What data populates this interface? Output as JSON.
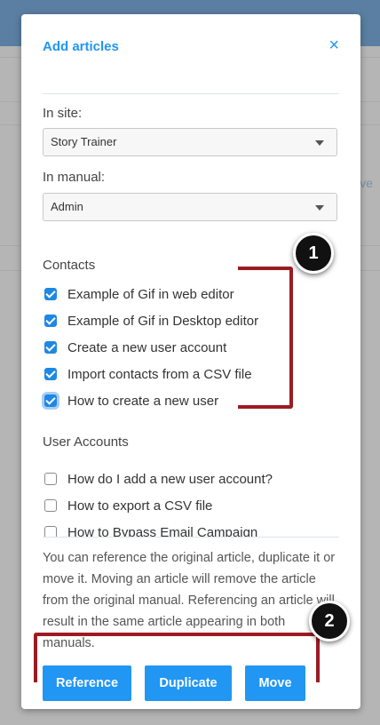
{
  "modal": {
    "title": "Add articles",
    "close_label": "×"
  },
  "site": {
    "label": "In site:",
    "selected": "Story Trainer"
  },
  "manual": {
    "label": "In manual:",
    "selected": "Admin"
  },
  "sections": [
    {
      "title": "Contacts",
      "items": [
        {
          "label": "Example of Gif in web editor",
          "checked": true
        },
        {
          "label": "Example of Gif in Desktop editor",
          "checked": true
        },
        {
          "label": "Create a new user account",
          "checked": true
        },
        {
          "label": "Import contacts from a CSV file",
          "checked": true
        },
        {
          "label": "How to create a new user",
          "checked": true,
          "focused": true
        }
      ]
    },
    {
      "title": "User Accounts",
      "items": [
        {
          "label": "How do I add a new user account?",
          "checked": false
        },
        {
          "label": "How to export a CSV file",
          "checked": false
        },
        {
          "label": "How to Bypass Email Campaign",
          "checked": false
        }
      ]
    }
  ],
  "info_text": "You can reference the original article, duplicate it or move it. Moving an article will remove the article from the original manual. Referencing an article will result in the same article appearing in both manuals.",
  "buttons": {
    "reference": "Reference",
    "duplicate": "Duplicate",
    "move": "Move"
  },
  "background": {
    "partial_text": "ve"
  },
  "annotations": {
    "badge1": "1",
    "badge2": "2"
  },
  "colors": {
    "accent": "#2196f3",
    "checkbox": "#1e88e5",
    "annotation": "#9b1c22"
  },
  "icons": {
    "close": "close-icon",
    "dropdown": "chevron-down-icon",
    "check": "check-icon"
  }
}
